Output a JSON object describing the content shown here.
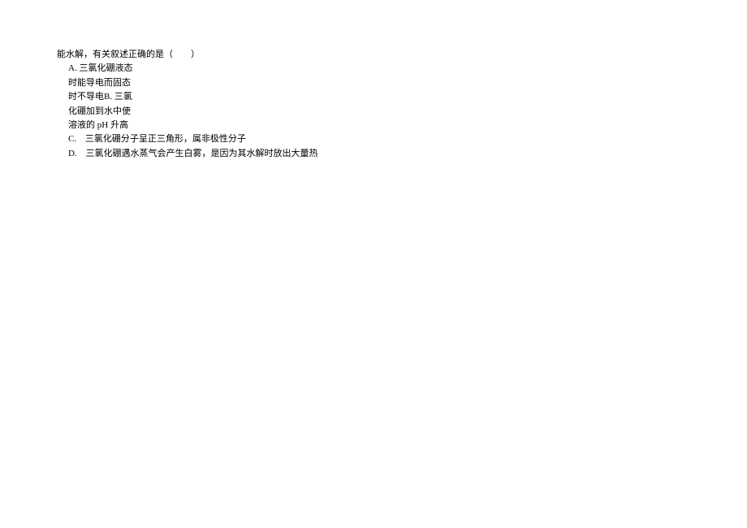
{
  "question": {
    "stem": "能水解，有关叙述正确的是（　　）",
    "optionA_line1": "A. 三氯化硼液态",
    "optionA_line2": "时能导电而固态",
    "optionA_line3": "时不导电B. 三氯",
    "optionA_line4": "化硼加到水中使",
    "optionA_line5": "溶液的 pH 升高",
    "optionC_label": "C.",
    "optionC_text": "三氯化硼分子呈正三角形，属非极性分子",
    "optionD_label": "D.",
    "optionD_text": "三氯化硼遇水蒸气会产生白雾，是因为其水解时放出大量热"
  }
}
